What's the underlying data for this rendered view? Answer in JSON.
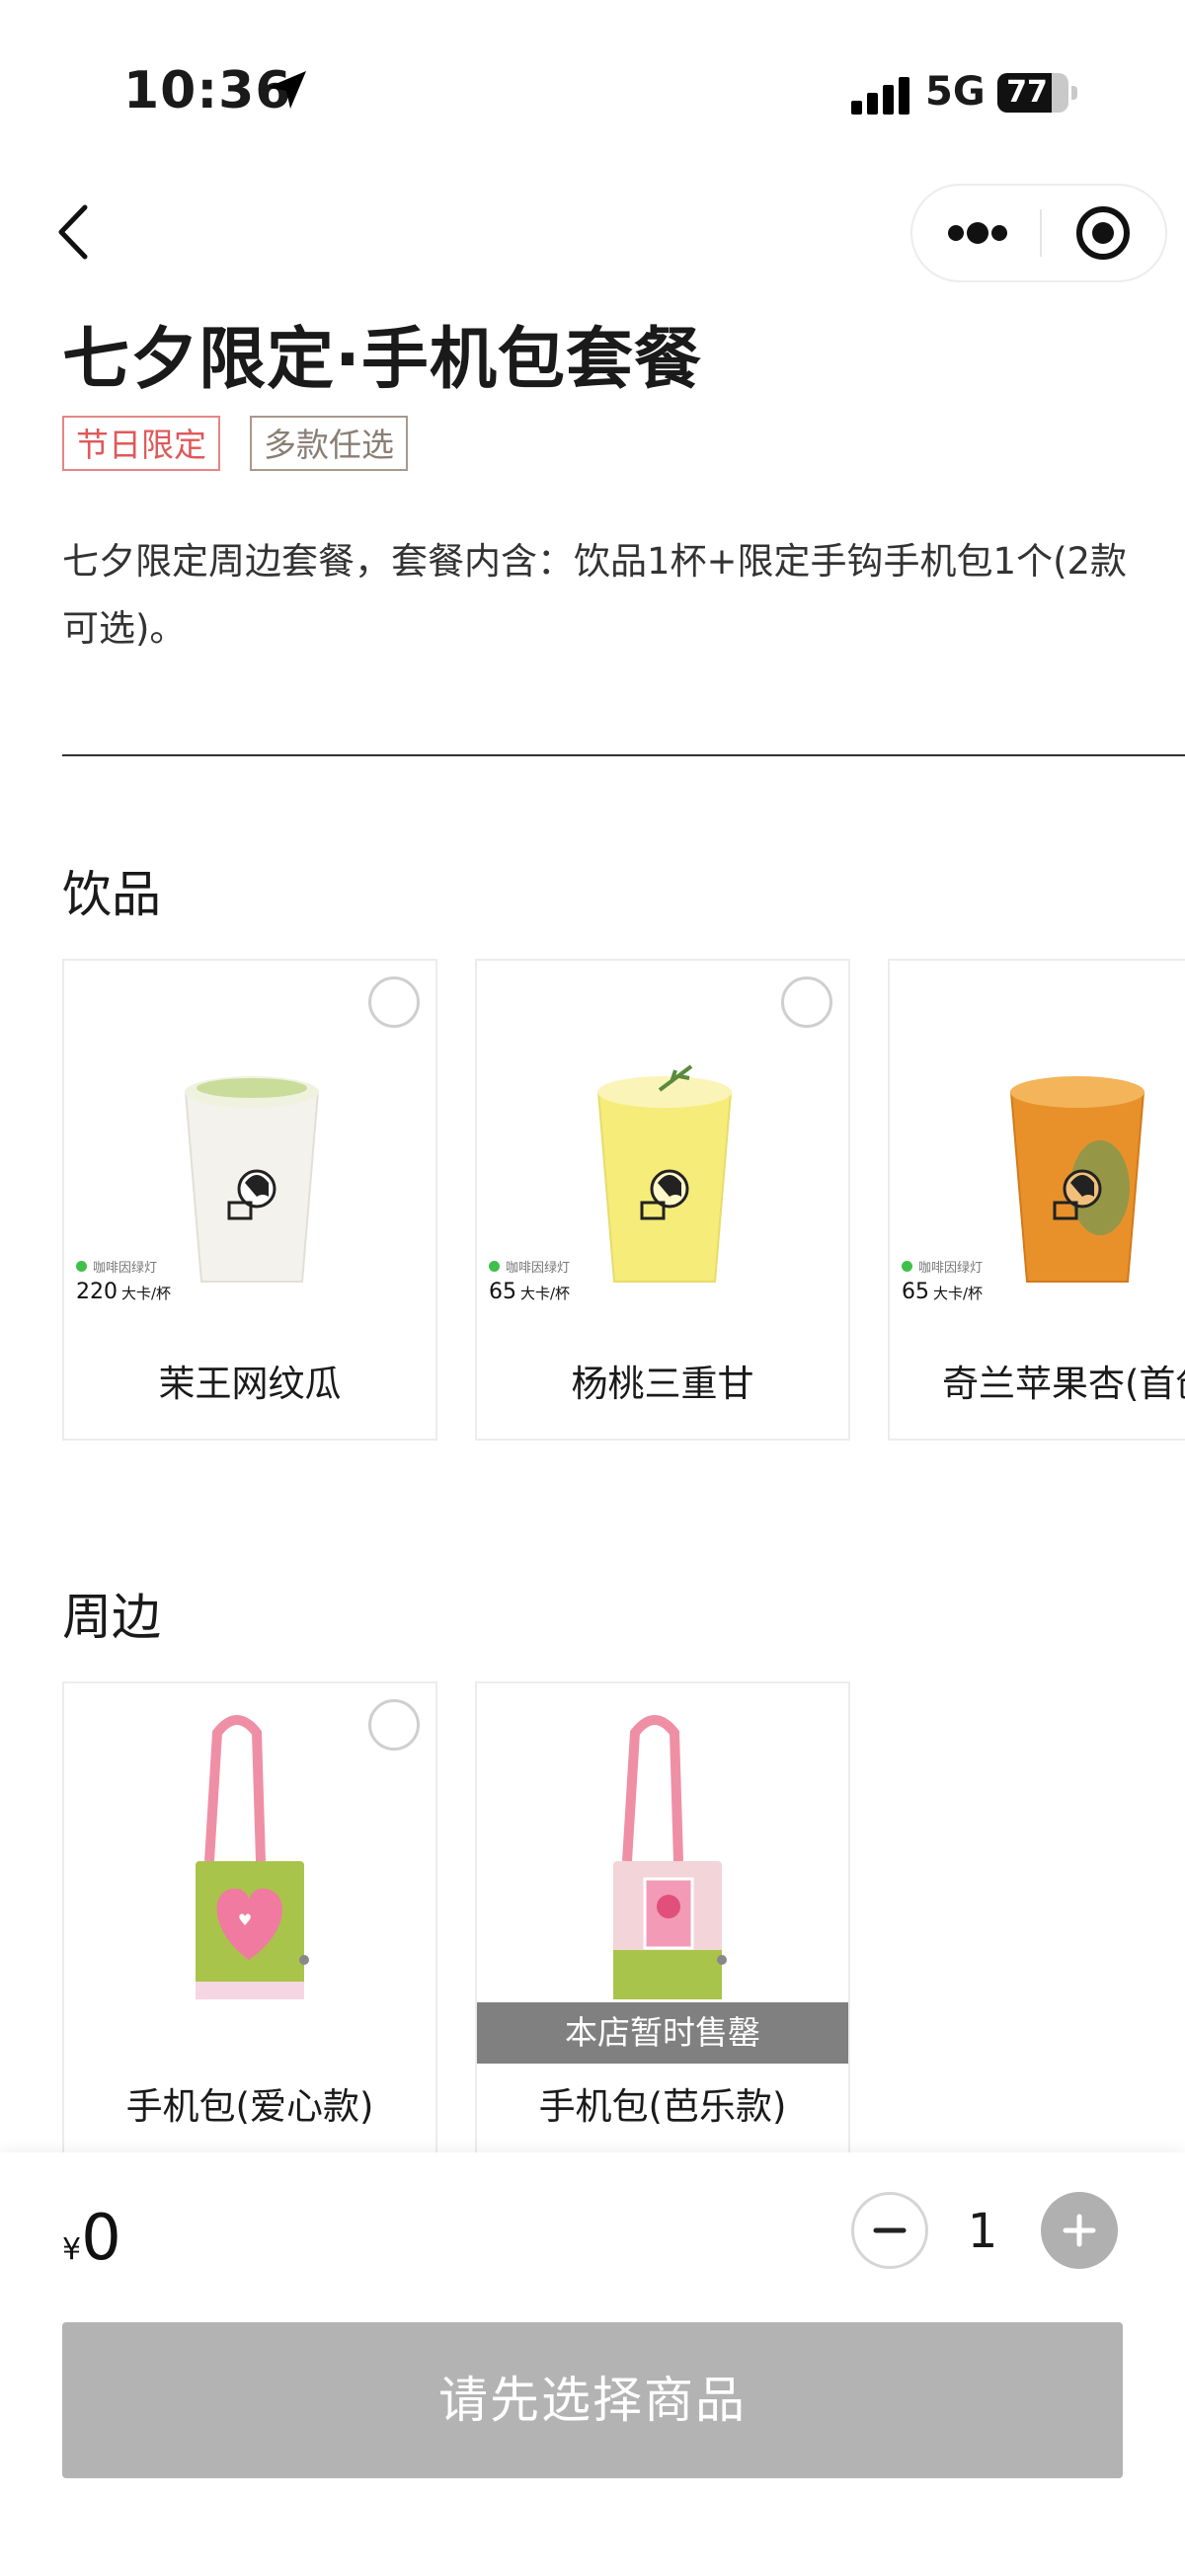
{
  "status_bar": {
    "time": "10:36",
    "network": "5G",
    "battery": "77",
    "battery_level": 0.77
  },
  "header": {
    "back_icon": "chevron-left-icon",
    "more_icon": "more-dots-icon",
    "close_icon": "target-close-icon"
  },
  "product": {
    "title": "七夕限定·手机包套餐",
    "tags": [
      "节日限定",
      "多款任选"
    ],
    "description": "七夕限定周边套餐，套餐内含：饮品1杯+限定手钩手机包1个(2款可选)。"
  },
  "sections": {
    "drinks": {
      "title": "饮品",
      "items": [
        {
          "name": "茉王网纹瓜",
          "calorie_label": "咖啡因绿灯",
          "calories": "220",
          "unit": "大卡/杯"
        },
        {
          "name": "杨桃三重甘",
          "calorie_label": "咖啡因绿灯",
          "calories": "65",
          "unit": "大卡/杯"
        },
        {
          "name": "奇兰苹果杏(首创",
          "calorie_label": "咖啡因绿灯",
          "calories": "65",
          "unit": "大卡/杯"
        }
      ]
    },
    "merch": {
      "title": "周边",
      "items": [
        {
          "name": "手机包(爱心款)",
          "badge": ""
        },
        {
          "name": "手机包(芭乐款)",
          "badge": "本店暂时售罄"
        }
      ]
    }
  },
  "cart": {
    "currency": "¥",
    "price": "0",
    "quantity": "1",
    "submit_label": "请先选择商品"
  },
  "colors": {
    "accent_red": "#e0585a",
    "tag_gray": "#8a7e74",
    "disabled_gray": "#b3b3b3",
    "caffeine_green": "#3fc04a"
  }
}
